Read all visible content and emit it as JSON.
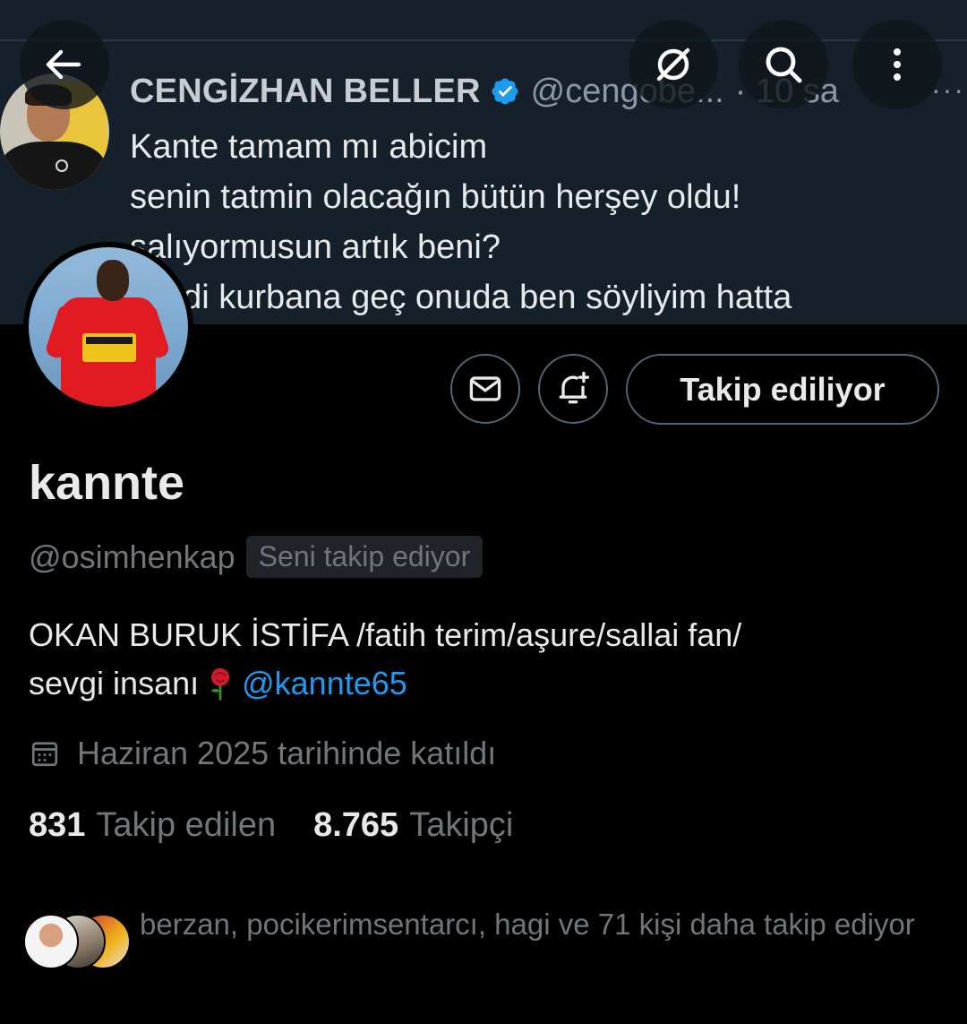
{
  "banner_tweet": {
    "author_name": "CENGİZHAN BELLER",
    "author_handle": "@cengobe...",
    "time": "· 10 sa",
    "more": "···",
    "lines": [
      "Kante tamam mı abicim",
      "senin tatmin olacağın bütün herşey oldu!",
      "salıyormusun artık beni?",
      "simdi kurbana geç onuda ben söyliyim hatta"
    ]
  },
  "nav": {
    "back_icon": "arrow-left-icon",
    "grok_icon": "grok-icon",
    "search_icon": "search-icon",
    "more_icon": "more-vertical-icon"
  },
  "profile": {
    "display_name": "kannte",
    "handle": "@osimhenkap",
    "follows_you": "Seni takip ediyor",
    "bio_text": "OKAN BURUK İSTİFA /fatih terim/aşure/sallai fan/",
    "bio_text_2": "sevgi insanı",
    "bio_mention": "@kannte65",
    "joined": "Haziran 2025 tarihinde katıldı",
    "following_count": "831",
    "following_label": "Takip edilen",
    "followers_count": "8.765",
    "followers_label": "Takipçi",
    "follow_button": "Takip ediliyor",
    "known_followers_text": "berzan, pocikerimsentarcı, hagi ve 71 kişi daha takip ediyor"
  },
  "colors": {
    "accent": "#1d9bf0",
    "background": "#000000",
    "secondary_text": "#71767b"
  }
}
